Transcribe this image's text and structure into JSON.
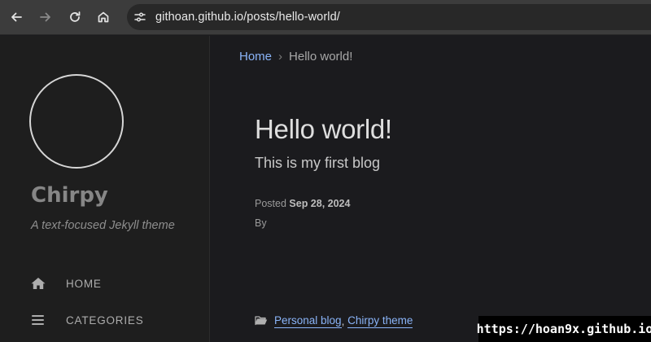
{
  "browser": {
    "url": "githoan.github.io/posts/hello-world/",
    "icons": [
      "back-icon",
      "forward-icon",
      "reload-icon",
      "home-icon",
      "site-settings-icon"
    ]
  },
  "sidebar": {
    "title": "Chirpy",
    "subtitle": "A text-focused Jekyll theme",
    "nav": [
      {
        "label": "HOME",
        "icon": "home-icon"
      },
      {
        "label": "CATEGORIES",
        "icon": "list-icon"
      }
    ]
  },
  "breadcrumb": {
    "home": "Home",
    "separator": "›",
    "current": "Hello world!"
  },
  "post": {
    "title": "Hello world!",
    "description": "This is my first blog",
    "posted_label": "Posted",
    "date": "Sep 28, 2024",
    "by_label": "By",
    "categories": [
      "Personal blog",
      "Chirpy theme"
    ],
    "category_separator": ","
  },
  "watermark": "https://hoan9x.github.io",
  "colors": {
    "link": "#8ab4f8",
    "background": "#1b1b1e",
    "sidebar": "#1e1e1e",
    "toolbar": "#3c3c3c"
  }
}
